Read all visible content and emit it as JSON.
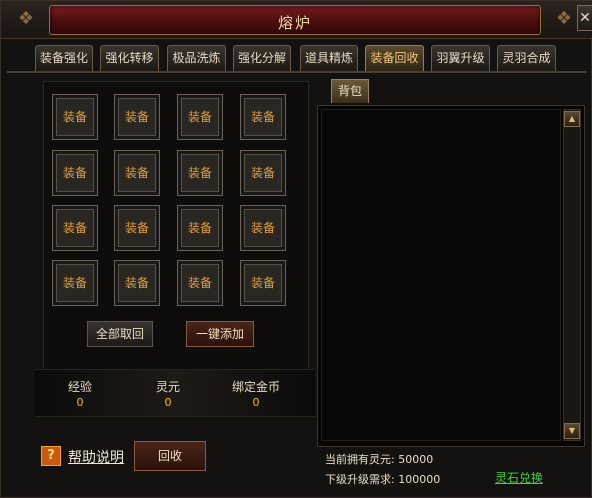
{
  "window": {
    "title": "熔炉",
    "close_label": "✕"
  },
  "tabs": [
    {
      "label": "装备强化"
    },
    {
      "label": "强化转移"
    },
    {
      "label": "极品洗炼"
    },
    {
      "label": "强化分解"
    },
    {
      "label": "道具精炼"
    },
    {
      "label": "装备回收",
      "active": true
    },
    {
      "label": "羽翼升级"
    },
    {
      "label": "灵羽合成"
    }
  ],
  "slots": {
    "label": "装备",
    "rows": 4,
    "cols": 4
  },
  "buttons": {
    "retrieve_all": "全部取回",
    "add_all": "一键添加",
    "recycle": "回收"
  },
  "stats": {
    "exp_label": "经验",
    "exp_value": "0",
    "spirit_label": "灵元",
    "spirit_value": "0",
    "gold_label": "绑定金币",
    "gold_value": "0"
  },
  "help": {
    "icon": "?",
    "label": "帮助说明"
  },
  "bag": {
    "tab_label": "背包"
  },
  "info": {
    "owned_label": "当前拥有灵元:",
    "owned_value": "50000",
    "need_label": "下级升级需求:",
    "need_value": "100000",
    "exchange_label": "灵石兑换"
  },
  "colors": {
    "accent": "#e0a040",
    "title_bg": "#5a1212",
    "link_green": "#40d040",
    "value_yellow": "#f0c000"
  }
}
